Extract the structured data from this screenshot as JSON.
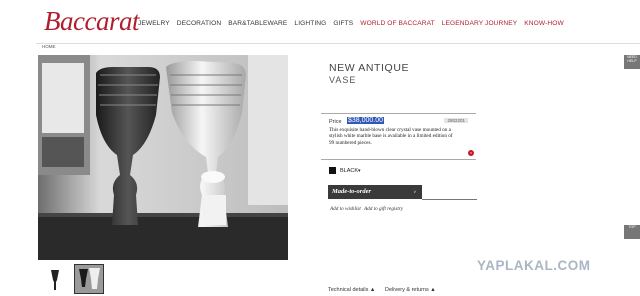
{
  "header": {
    "logo": "Baccarat",
    "nav": [
      {
        "label": "JEWELRY",
        "color": "#333333"
      },
      {
        "label": "DECORATION",
        "color": "#333333"
      },
      {
        "label": "BAR&TABLEWARE",
        "color": "#333333"
      },
      {
        "label": "LIGHTING",
        "color": "#333333"
      },
      {
        "label": "GIFTS",
        "color": "#333333"
      },
      {
        "label": "WORLD OF BACCARAT",
        "color": "#b01e2e"
      },
      {
        "label": "LEGENDARY JOURNEY",
        "color": "#b01e2e"
      },
      {
        "label": "KNOW-HOW",
        "color": "#b01e2e"
      }
    ]
  },
  "breadcrumb": "HOME",
  "product": {
    "title_line1": "NEW ANTIQUE",
    "title_line2": "VASE",
    "price_label": "Price",
    "price": "$38,000.00",
    "reference": "2802201",
    "description": "This exquisite hand-blown clear crystal vase mounted on a stylish white marble base is available in a limited edition of 99 numbered pieces.",
    "color_label": "BLACK",
    "made_to_order": "Made-to-order",
    "wishlist": "Add to wishlist",
    "gift_registry": "Add to gift registry",
    "technical_details": "Technical details",
    "delivery_returns": "Delivery & returns"
  },
  "side_tabs": {
    "top": "NEED HELP",
    "bottom": "TOP"
  },
  "watermark": "YAPLAKAL.COM"
}
